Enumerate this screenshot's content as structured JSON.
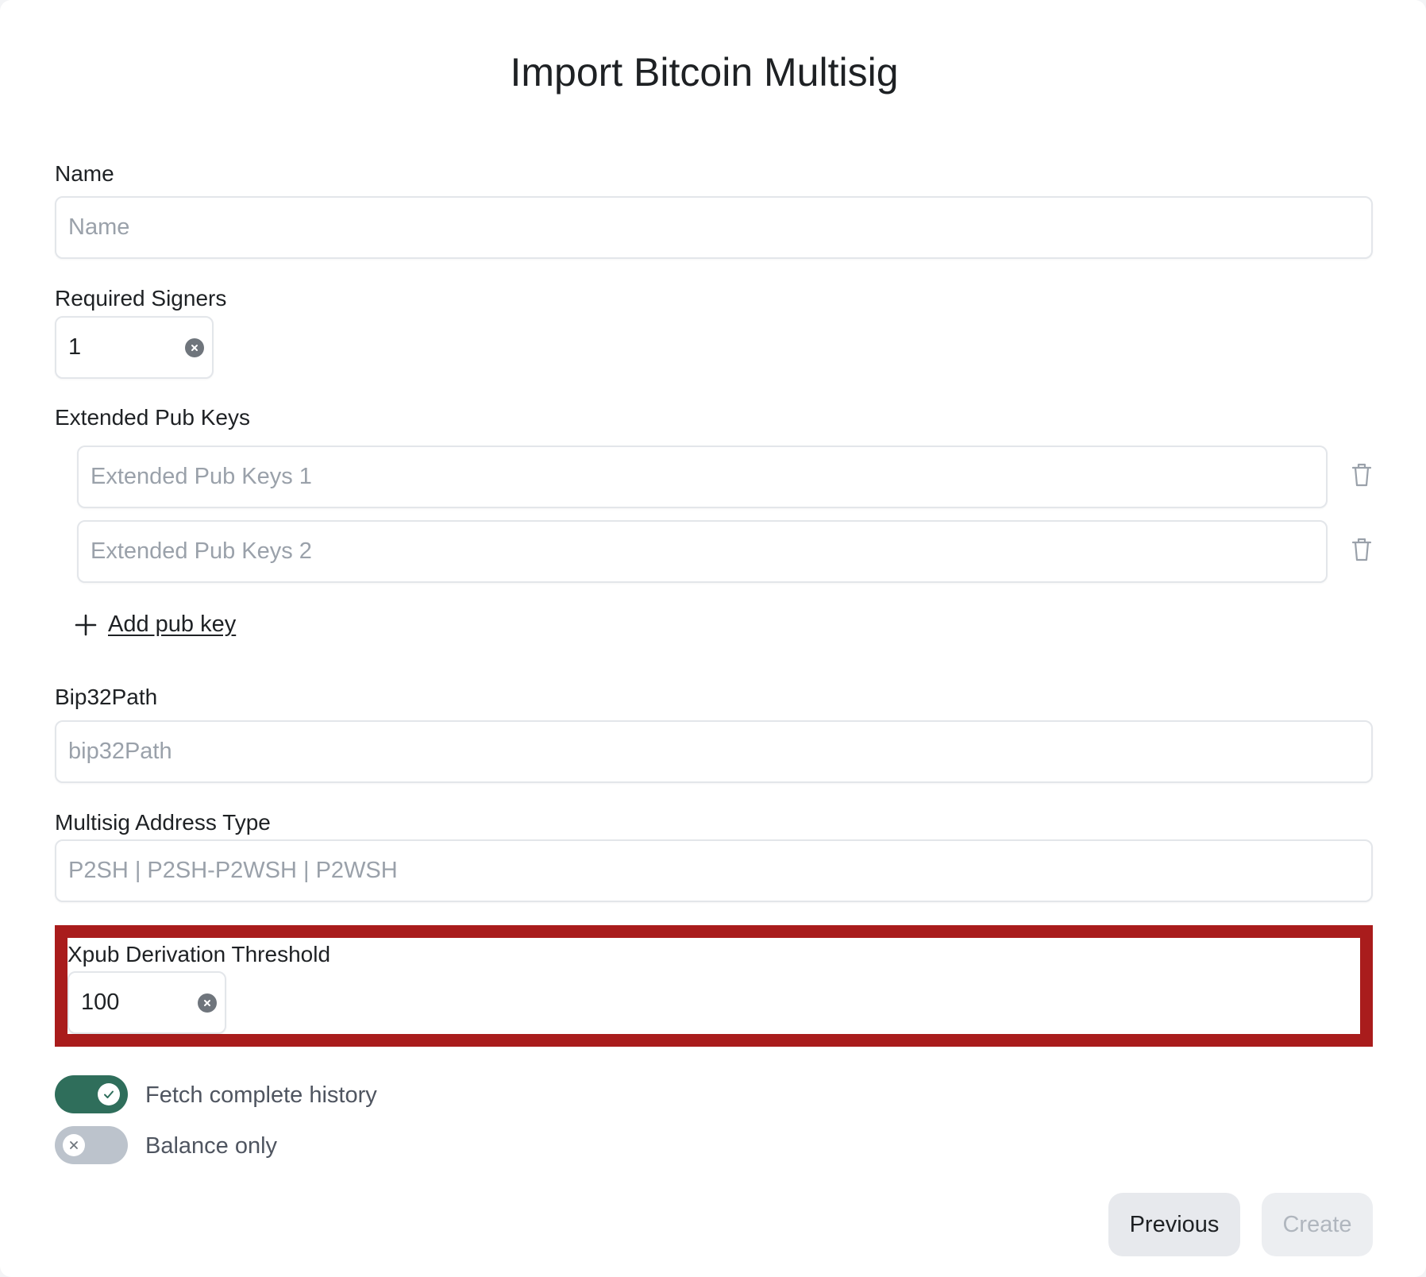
{
  "modal": {
    "title": "Import Bitcoin Multisig"
  },
  "fields": {
    "name": {
      "label": "Name",
      "placeholder": "Name",
      "value": ""
    },
    "required_signers": {
      "label": "Required Signers",
      "value": "1"
    },
    "extended_pub_keys": {
      "label": "Extended Pub Keys",
      "items": [
        {
          "placeholder": "Extended Pub Keys 1",
          "value": ""
        },
        {
          "placeholder": "Extended Pub Keys 2",
          "value": ""
        }
      ],
      "add_label": "Add pub key"
    },
    "bip32path": {
      "label": "Bip32Path",
      "placeholder": "bip32Path",
      "value": ""
    },
    "multisig_address_type": {
      "label": "Multisig Address Type",
      "placeholder": "P2SH | P2SH-P2WSH | P2WSH",
      "value": ""
    },
    "xpub_derivation_threshold": {
      "label": "Xpub Derivation Threshold",
      "value": "100"
    }
  },
  "toggles": [
    {
      "label": "Fetch complete history",
      "on": true
    },
    {
      "label": "Balance only",
      "on": false
    }
  ],
  "buttons": {
    "previous": "Previous",
    "create": "Create"
  },
  "colors": {
    "highlight_border": "#a91c1c",
    "toggle_on": "#2f6e5b",
    "toggle_off": "#bcc3cc"
  }
}
